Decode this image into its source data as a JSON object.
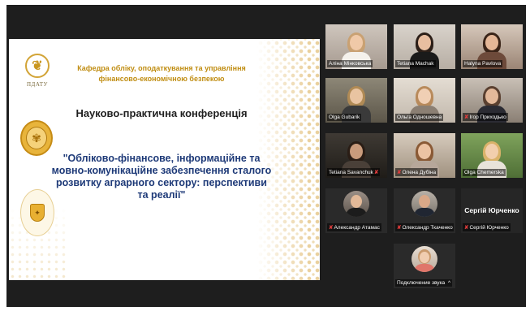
{
  "slide": {
    "logo1_text": "ПДАТУ",
    "department": "Кафедра обліку, оподаткування та управління фінансово-економічною безпекою",
    "conference_type": "Науково-практична конференція",
    "conference_title": "\"Обліково-фінансове, інформаційне та мовно-комунікаційне забезпечення сталого розвитку аграрного сектору: перспективи та реалії\""
  },
  "participants": [
    {
      "name": "Аліна Мінковська",
      "muted": false
    },
    {
      "name": "Tetiana Machak",
      "muted": false
    },
    {
      "name": "Halyna Pavlova",
      "muted": false
    },
    {
      "name": "Olga Gubarik",
      "muted": false,
      "active": true
    },
    {
      "name": "Ольга Одношевна",
      "muted": false
    },
    {
      "name": "Ігор Приходько",
      "muted": true
    },
    {
      "name": "Tetiana Savanchuk",
      "muted": true
    },
    {
      "name": "Олена Дубіна",
      "muted": true
    },
    {
      "name": "Olga Chemerska",
      "muted": false
    },
    {
      "name": "Александр Атамас",
      "muted": true
    },
    {
      "name": "Олександр Ткаченко",
      "muted": true
    },
    {
      "name": "Сергій Юрченко",
      "muted": true,
      "display_name": "Сергій Юрченко"
    },
    {
      "name": "Подключение звука",
      "suffix": "^"
    }
  ],
  "colors": {
    "window_bg": "#1e1e1e",
    "active_speaker": "#c9d85a",
    "department_text": "#c08d12",
    "title_text": "#1e3a78",
    "muted_icon": "#e03c3c"
  }
}
